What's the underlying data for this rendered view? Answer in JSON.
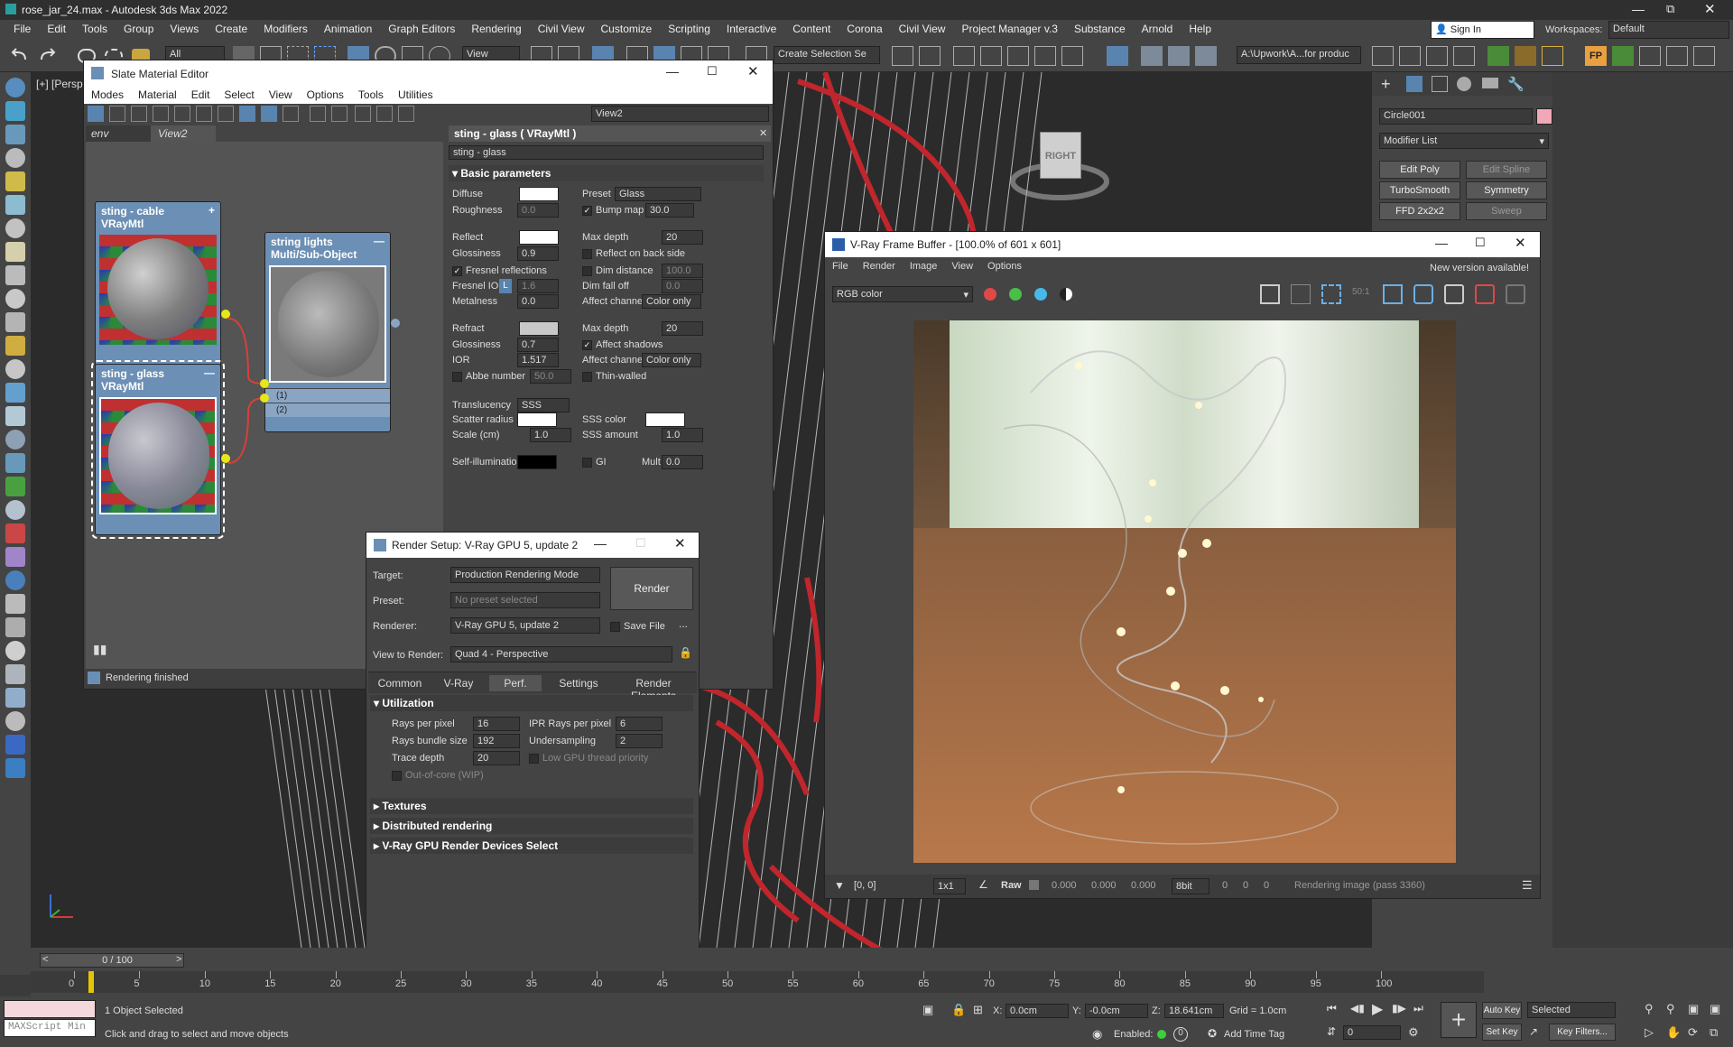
{
  "app": {
    "title": "rose_jar_24.max - Autodesk 3ds Max 2022",
    "sign_in": "Sign In",
    "workspaces_label": "Workspaces:",
    "workspace_value": "Default"
  },
  "menu": [
    "File",
    "Edit",
    "Tools",
    "Group",
    "Views",
    "Create",
    "Modifiers",
    "Animation",
    "Graph Editors",
    "Rendering",
    "Civil View",
    "Customize",
    "Scripting",
    "Interactive",
    "Content",
    "Corona",
    "Civil View",
    "Project Manager v.3",
    "Substance",
    "Arnold",
    "Help"
  ],
  "toolbar": {
    "filter_value": "All",
    "view_value": "View",
    "selection_set": "Create Selection Se",
    "path": "A:\\Upwork\\A...for produc"
  },
  "viewport": {
    "label": "[+] [Persp",
    "viewcube_label": "RIGHT"
  },
  "cmdpanel": {
    "object_name": "Circle001",
    "modifier_list": "Modifier List",
    "buttons": [
      "Edit Poly",
      "Edit Spline",
      "TurboSmooth",
      "Symmetry",
      "FFD 2x2x2",
      "Sweep"
    ]
  },
  "slate": {
    "title": "Slate Material Editor",
    "menu": [
      "Modes",
      "Material",
      "Edit",
      "Select",
      "View",
      "Options",
      "Tools",
      "Utilities"
    ],
    "view_dropdown": "View2",
    "tabs": [
      "env",
      "View2"
    ],
    "nodes": [
      {
        "title": "sting - cable",
        "type": "VRayMtl"
      },
      {
        "title": "string lights",
        "type": "Multi/Sub-Object"
      },
      {
        "title": "sting - glass",
        "type": "VRayMtl"
      }
    ],
    "slots": [
      "(1)",
      "(2)"
    ],
    "status": "Rendering finished",
    "params": {
      "header": "sting - glass  ( VRayMtl )",
      "name_field": "sting - glass",
      "rollout": "Basic parameters",
      "diffuse": "Diffuse",
      "preset_label": "Preset",
      "preset_value": "Glass",
      "roughness": "Roughness",
      "roughness_value": "0.0",
      "bump_map": "Bump map",
      "bump_value": "30.0",
      "reflect": "Reflect",
      "max_depth": "Max depth",
      "max_depth_value": "20",
      "glossiness": "Glossiness",
      "refl_gloss_value": "0.9",
      "reflect_back": "Reflect on back side",
      "fresnel": "Fresnel reflections",
      "dim_distance": "Dim distance",
      "dim_distance_value": "100.0",
      "fresnel_ior": "Fresnel IOR",
      "fresnel_ior_lock": "L",
      "fresnel_ior_value": "1.6",
      "dim_falloff": "Dim fall off",
      "dim_falloff_value": "0.0",
      "metalness": "Metalness",
      "metalness_value": "0.0",
      "affect_channels": "Affect channels",
      "affect_channels_value": "Color only",
      "refract": "Refract",
      "refr_max_depth_value": "20",
      "refr_gloss_value": "0.7",
      "affect_shadows": "Affect shadows",
      "ior": "IOR",
      "ior_value": "1.517",
      "abbe": "Abbe number",
      "abbe_value": "50.0",
      "thin_walled": "Thin-walled",
      "translucency": "Translucency",
      "translucency_value": "SSS",
      "scatter_radius": "Scatter radius",
      "sss_color": "SSS color",
      "scale": "Scale (cm)",
      "scale_value": "1.0",
      "sss_amount": "SSS amount",
      "sss_amount_value": "1.0",
      "self_illum": "Self-illumination",
      "gi": "GI",
      "mult": "Mult",
      "mult_value": "0.0"
    }
  },
  "render_setup": {
    "title": "Render Setup: V-Ray GPU 5, update 2",
    "target_label": "Target:",
    "target_value": "Production Rendering Mode",
    "preset_label": "Preset:",
    "preset_value": "No preset selected",
    "renderer_label": "Renderer:",
    "renderer_value": "V-Ray GPU 5, update 2",
    "save_file": "Save File",
    "view_label": "View to Render:",
    "view_value": "Quad 4 - Perspective",
    "render_button": "Render",
    "ellipsis": "...",
    "tabs": [
      "Common",
      "V-Ray",
      "Perf.",
      "Settings",
      "Render Elements"
    ],
    "utilization": "Utilization",
    "rays_per_pixel": "Rays per pixel",
    "rays_per_pixel_value": "16",
    "ipr_rays": "IPR Rays per pixel",
    "ipr_rays_value": "6",
    "bundle_size": "Rays bundle size",
    "bundle_size_value": "192",
    "undersampling": "Undersampling",
    "undersampling_value": "2",
    "trace_depth": "Trace depth",
    "trace_depth_value": "20",
    "low_gpu": "Low GPU thread priority",
    "out_of_core": "Out-of-core (WIP)",
    "rollouts": [
      "Textures",
      "Distributed rendering",
      "V-Ray GPU Render Devices Select"
    ]
  },
  "vfb": {
    "title": "V-Ray Frame Buffer - [100.0% of 601 x 601]",
    "menu": [
      "File",
      "Render",
      "Image",
      "View",
      "Options"
    ],
    "new_version": "New version available!",
    "channel": "RGB color",
    "coords": "[0, 0]",
    "zoom": "1x1",
    "raw": "Raw",
    "vals": [
      "0.000",
      "0.000",
      "0.000"
    ],
    "bits": "8bit",
    "ints": [
      "0",
      "0",
      "0"
    ],
    "status": "Rendering image (pass 3360)",
    "zoom_label": "50:1"
  },
  "timeline": {
    "frame": "0 / 100",
    "ticks": [
      "0",
      "5",
      "10",
      "15",
      "20",
      "25",
      "30",
      "35",
      "40",
      "45",
      "50",
      "55",
      "60",
      "65",
      "70",
      "75",
      "80",
      "85",
      "90",
      "95",
      "100"
    ]
  },
  "statusbar": {
    "maxscript": "MAXScript Min",
    "selected": "1 Object Selected",
    "prompt": "Click and drag to select and move objects",
    "x_label": "X:",
    "x_value": "0.0cm",
    "y_label": "Y:",
    "y_value": "-0.0cm",
    "z_label": "Z:",
    "z_value": "18.641cm",
    "grid": "Grid = 1.0cm",
    "enabled": "Enabled:",
    "add_time_tag": "Add Time Tag",
    "auto_key": "Auto Key",
    "set_key": "Set Key",
    "selected_dd": "Selected",
    "key_filters": "Key Filters...",
    "frame_value": "0"
  }
}
